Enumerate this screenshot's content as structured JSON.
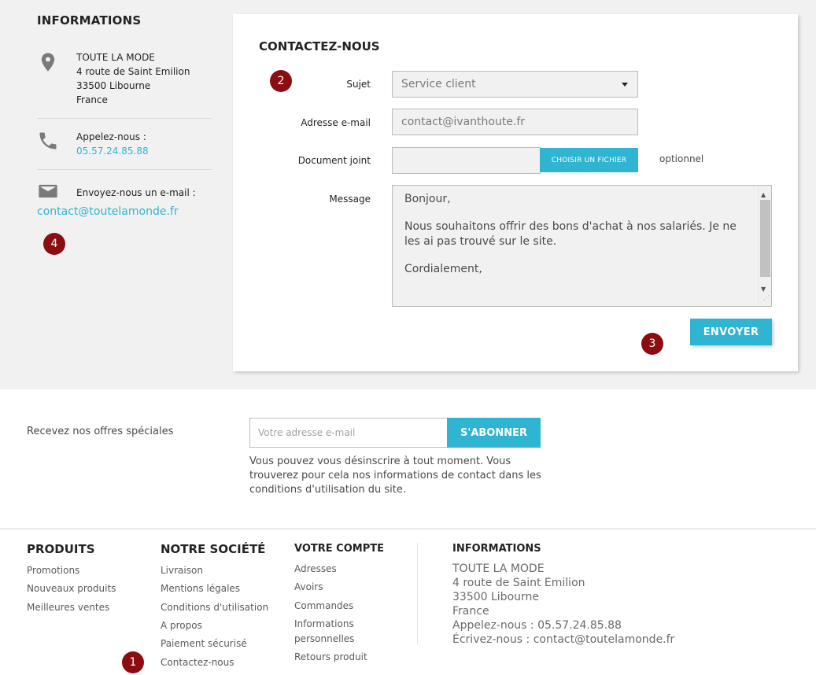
{
  "info": {
    "title": "INFORMATIONS",
    "address_lines": [
      "TOUTE LA MODE",
      "4 route de Saint Emilion",
      "33500 Libourne",
      "France"
    ],
    "call_label": "Appelez-nous :",
    "phone": "05.57.24.85.88",
    "email_label": "Envoyez-nous un e-mail :",
    "email": "contact@toutelamonde.fr"
  },
  "contact_form": {
    "title": "CONTACTEZ-NOUS",
    "subject_label": "Sujet",
    "subject_value": "Service client",
    "email_label": "Adresse e-mail",
    "email_value": "contact@ivanthoute.fr",
    "attachment_label": "Document joint",
    "choose_file_label": "CHOISIR UN FICHIER",
    "optional_label": "optionnel",
    "message_label": "Message",
    "message_paragraphs": [
      "Bonjour,",
      "Nous souhaitons offrir des bons d'achat à nos salariés. Je ne les ai pas trouvé sur le site.",
      "Cordialement,"
    ],
    "send_label": "ENVOYER"
  },
  "markers": [
    "1",
    "2",
    "3",
    "4"
  ],
  "newsletter": {
    "label": "Recevez nos offres spéciales",
    "placeholder": "Votre adresse e-mail",
    "button": "S'ABONNER",
    "note": "Vous pouvez vous désinscrire à tout moment. Vous trouverez pour cela nos informations de contact dans les conditions d'utilisation du site."
  },
  "footer": {
    "products": {
      "title": "PRODUITS",
      "items": [
        "Promotions",
        "Nouveaux produits",
        "Meilleures ventes"
      ]
    },
    "company": {
      "title": "NOTRE SOCIÉTÉ",
      "items": [
        "Livraison",
        "Mentions légales",
        "Conditions d'utilisation",
        "A propos",
        "Paiement sécurisé",
        "Contactez-nous"
      ]
    },
    "account": {
      "title": "VOTRE COMPTE",
      "items": [
        "Adresses",
        "Avoirs",
        "Commandes",
        "Informations",
        "personnelles",
        "Retours produit"
      ]
    },
    "info": {
      "title": "INFORMATIONS",
      "lines": [
        "TOUTE LA MODE",
        "4 route de Saint Emilion",
        "33500 Libourne",
        "France",
        "Appelez-nous : 05.57.24.85.88",
        "Écrivez-nous : contact@toutelamonde.fr"
      ]
    }
  },
  "colors": {
    "accent": "#2fb5d2",
    "marker": "#8b0d12",
    "band": "#f1f1f1"
  }
}
